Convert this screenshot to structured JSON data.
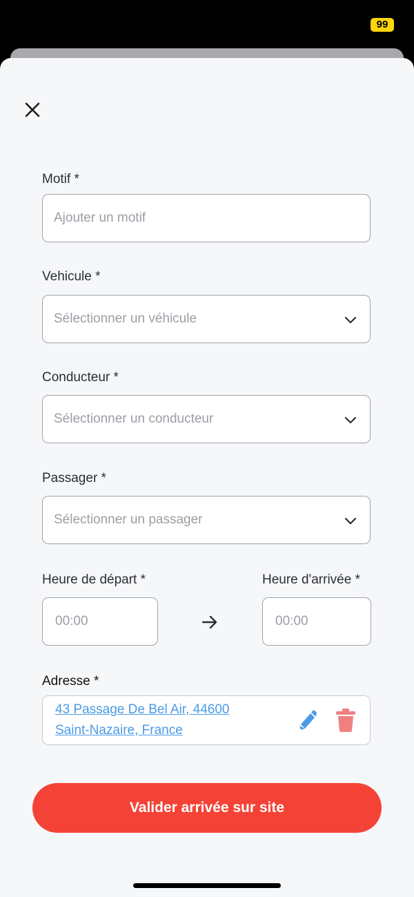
{
  "status_bar": {
    "battery": "99"
  },
  "form": {
    "motif": {
      "label": "Motif *",
      "placeholder": "Ajouter un motif"
    },
    "vehicule": {
      "label": "Vehicule *",
      "placeholder": "Sélectionner un véhicule"
    },
    "conducteur": {
      "label": "Conducteur *",
      "placeholder": "Sélectionner un conducteur"
    },
    "passager": {
      "label": "Passager *",
      "placeholder": "Sélectionner un passager"
    },
    "depart": {
      "label": "Heure de départ *",
      "value": "00:00"
    },
    "arrivee": {
      "label": "Heure d'arrivée *",
      "value": "00:00"
    },
    "adresse": {
      "label": "Adresse *",
      "line1": "43 Passage De Bel Air, 44600",
      "line2": "Saint-Nazaire, France"
    }
  },
  "submit_label": "Valider arrivée sur site",
  "colors": {
    "accent": "#f44336",
    "link": "#4a9be3",
    "trash": "#f08080",
    "battery": "#ffd60a"
  },
  "icons": [
    "close-icon",
    "chevron-down-icon",
    "arrow-right-icon",
    "pencil-icon",
    "trash-icon"
  ]
}
